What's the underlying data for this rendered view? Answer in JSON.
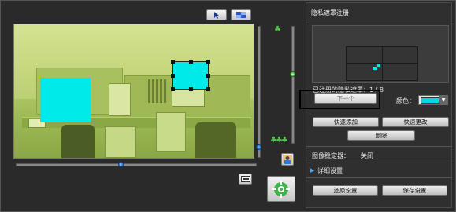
{
  "toolbar": {
    "pointer_icon": "pointer-icon",
    "view_icon": "layout-icon"
  },
  "video": {
    "zoom_icon_top": "tele-tree-icon",
    "zoom_icon_bottom": "wide-tree-icon"
  },
  "right_panel": {
    "title": "隐私遮罩注册",
    "count_text": "已注册的隐私遮罩：1 / 8",
    "next_button": "下一个",
    "color_label": "颜色：",
    "color_value": "#00d8e8",
    "quick_add_button": "快速添加",
    "quick_change_button": "快速更改",
    "delete_button": "删除",
    "stabilizer_label": "图像稳定器：",
    "stabilizer_value": "关闭",
    "details_label": "详细设置",
    "restore_button": "还原设置",
    "save_button": "保存设置"
  },
  "colors": {
    "mask": "#00eaea",
    "panel_bg": "#2f2f2f",
    "highlight_border": "#000000"
  }
}
